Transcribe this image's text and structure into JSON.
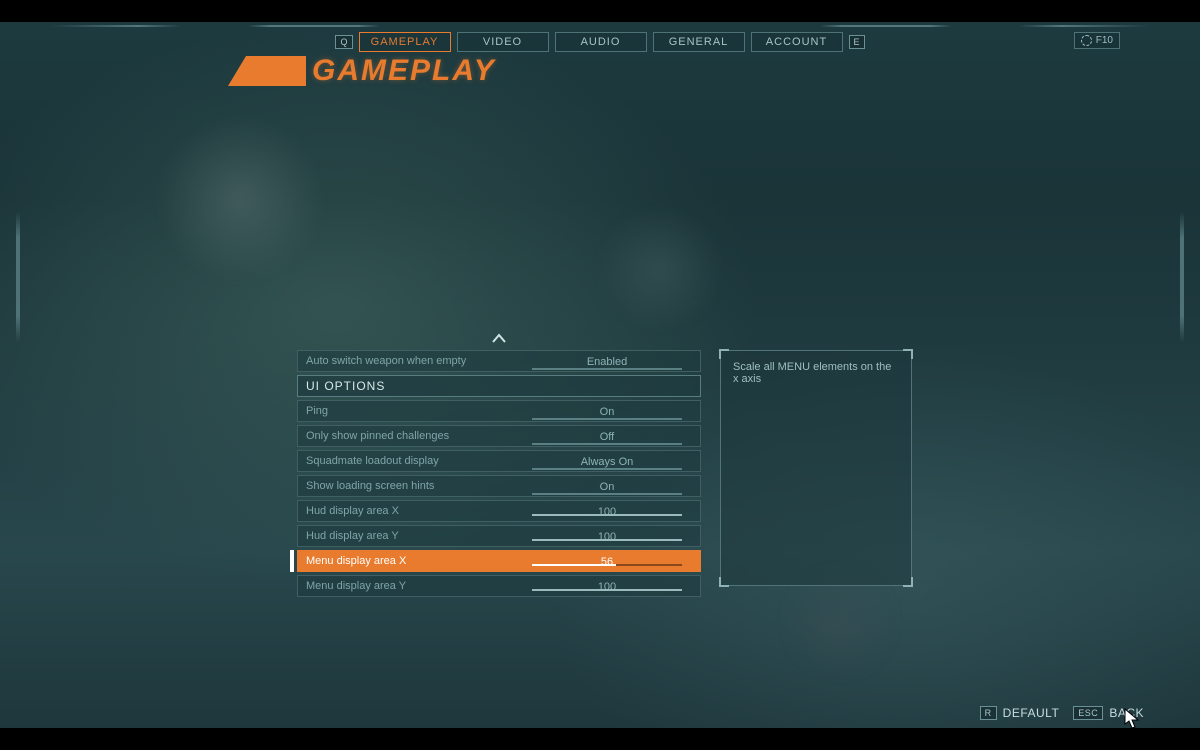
{
  "tabs": {
    "prev_key": "Q",
    "next_key": "E",
    "items": [
      "GAMEPLAY",
      "VIDEO",
      "AUDIO",
      "GENERAL",
      "ACCOUNT"
    ],
    "active": "GAMEPLAY"
  },
  "f10_label": "F10",
  "title": "GAMEPLAY",
  "section_header": "UI OPTIONS",
  "options": [
    {
      "label": "Auto switch weapon when empty",
      "value": "Enabled",
      "type": "toggle"
    },
    {
      "header": true,
      "label": "UI OPTIONS"
    },
    {
      "label": "Ping",
      "value": "On",
      "type": "toggle"
    },
    {
      "label": "Only show pinned challenges",
      "value": "Off",
      "type": "toggle"
    },
    {
      "label": "Squadmate loadout display",
      "value": "Always On",
      "type": "toggle"
    },
    {
      "label": "Show loading screen hints",
      "value": "On",
      "type": "toggle"
    },
    {
      "label": "Hud display area X",
      "value": "100",
      "type": "slider",
      "pct": 100
    },
    {
      "label": "Hud display area Y",
      "value": "100",
      "type": "slider",
      "pct": 100
    },
    {
      "label": "Menu display area X",
      "value": "56",
      "type": "slider",
      "pct": 56,
      "selected": true
    },
    {
      "label": "Menu display area Y",
      "value": "100",
      "type": "slider",
      "pct": 100
    }
  ],
  "description": "Scale all MENU elements on the x axis",
  "footer": {
    "default_key": "R",
    "default_label": "DEFAULT",
    "back_key": "ESC",
    "back_label": "BACK"
  }
}
